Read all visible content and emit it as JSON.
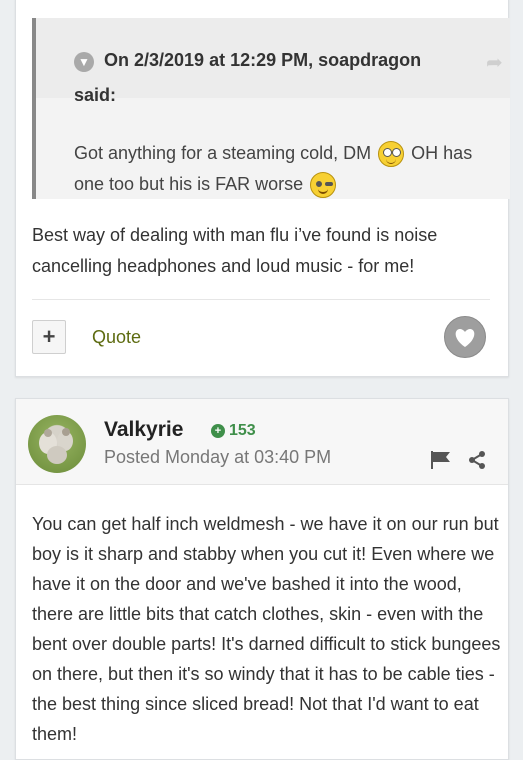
{
  "quoted_post": {
    "attribution": "On 2/3/2019 at 12:29 PM, soapdragon",
    "said": "said:",
    "text_before_emoji": "Got anything for a steaming cold, DM",
    "text_after_emoji1": "OH has one too but his is FAR worse",
    "emoji1": "rolling-eyes-emoji",
    "emoji2": "wink-emoji"
  },
  "reply_text": "Best way of dealing with man flu i’ve found is noise cancelling headphones and loud music - for me!",
  "actions": {
    "plus_label": "+",
    "quote_label": "Quote"
  },
  "post2": {
    "author": "Valkyrie",
    "reputation": "153",
    "posted": "Posted Monday at 03:40 PM",
    "body": "You can get half inch weldmesh - we have it on our run but boy is it sharp and stabby when you cut it!  Even where we have it on the door and we've bashed it into the wood, there are little bits that catch clothes, skin - even with the bent over double parts!  It's darned difficult to stick bungees on there, but then it's so windy that it has to be cable ties - the best thing since sliced bread!  Not that I'd want to eat them!"
  },
  "colors": {
    "accent_green": "#5d6b10",
    "rep_green": "#3f8f4a",
    "page_bg": "#eceff1"
  }
}
